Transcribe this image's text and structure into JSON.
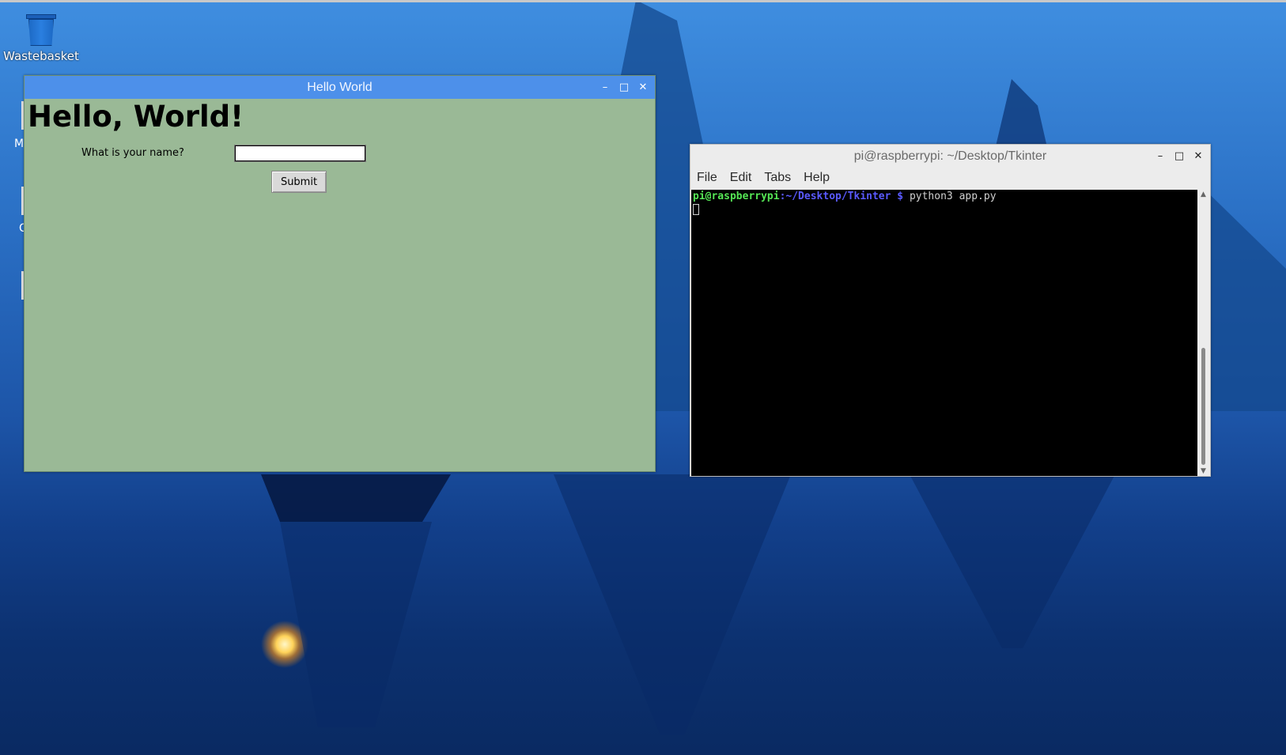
{
  "desktop": {
    "icons": [
      {
        "label": "Wastebasket"
      }
    ],
    "peek_labels": [
      "M",
      "C"
    ]
  },
  "hello_window": {
    "title": "Hello World",
    "heading": "Hello, World!",
    "prompt": "What is your name?",
    "name_value": "",
    "submit_label": "Submit",
    "controls": {
      "minimize": "–",
      "maximize": "□",
      "close": "✕"
    },
    "bg_color": "#9ab996",
    "titlebar_color": "#4d90ea"
  },
  "terminal_window": {
    "title": "pi@raspberrypi: ~/Desktop/Tkinter",
    "menu": [
      "File",
      "Edit",
      "Tabs",
      "Help"
    ],
    "prompt_user": "pi@raspberrypi",
    "prompt_sep": ":",
    "prompt_path": "~/Desktop/Tkinter $",
    "command": "python3 app.py",
    "controls": {
      "minimize": "–",
      "maximize": "□",
      "close": "✕"
    },
    "scroll": {
      "up": "▲",
      "down": "▼"
    }
  }
}
